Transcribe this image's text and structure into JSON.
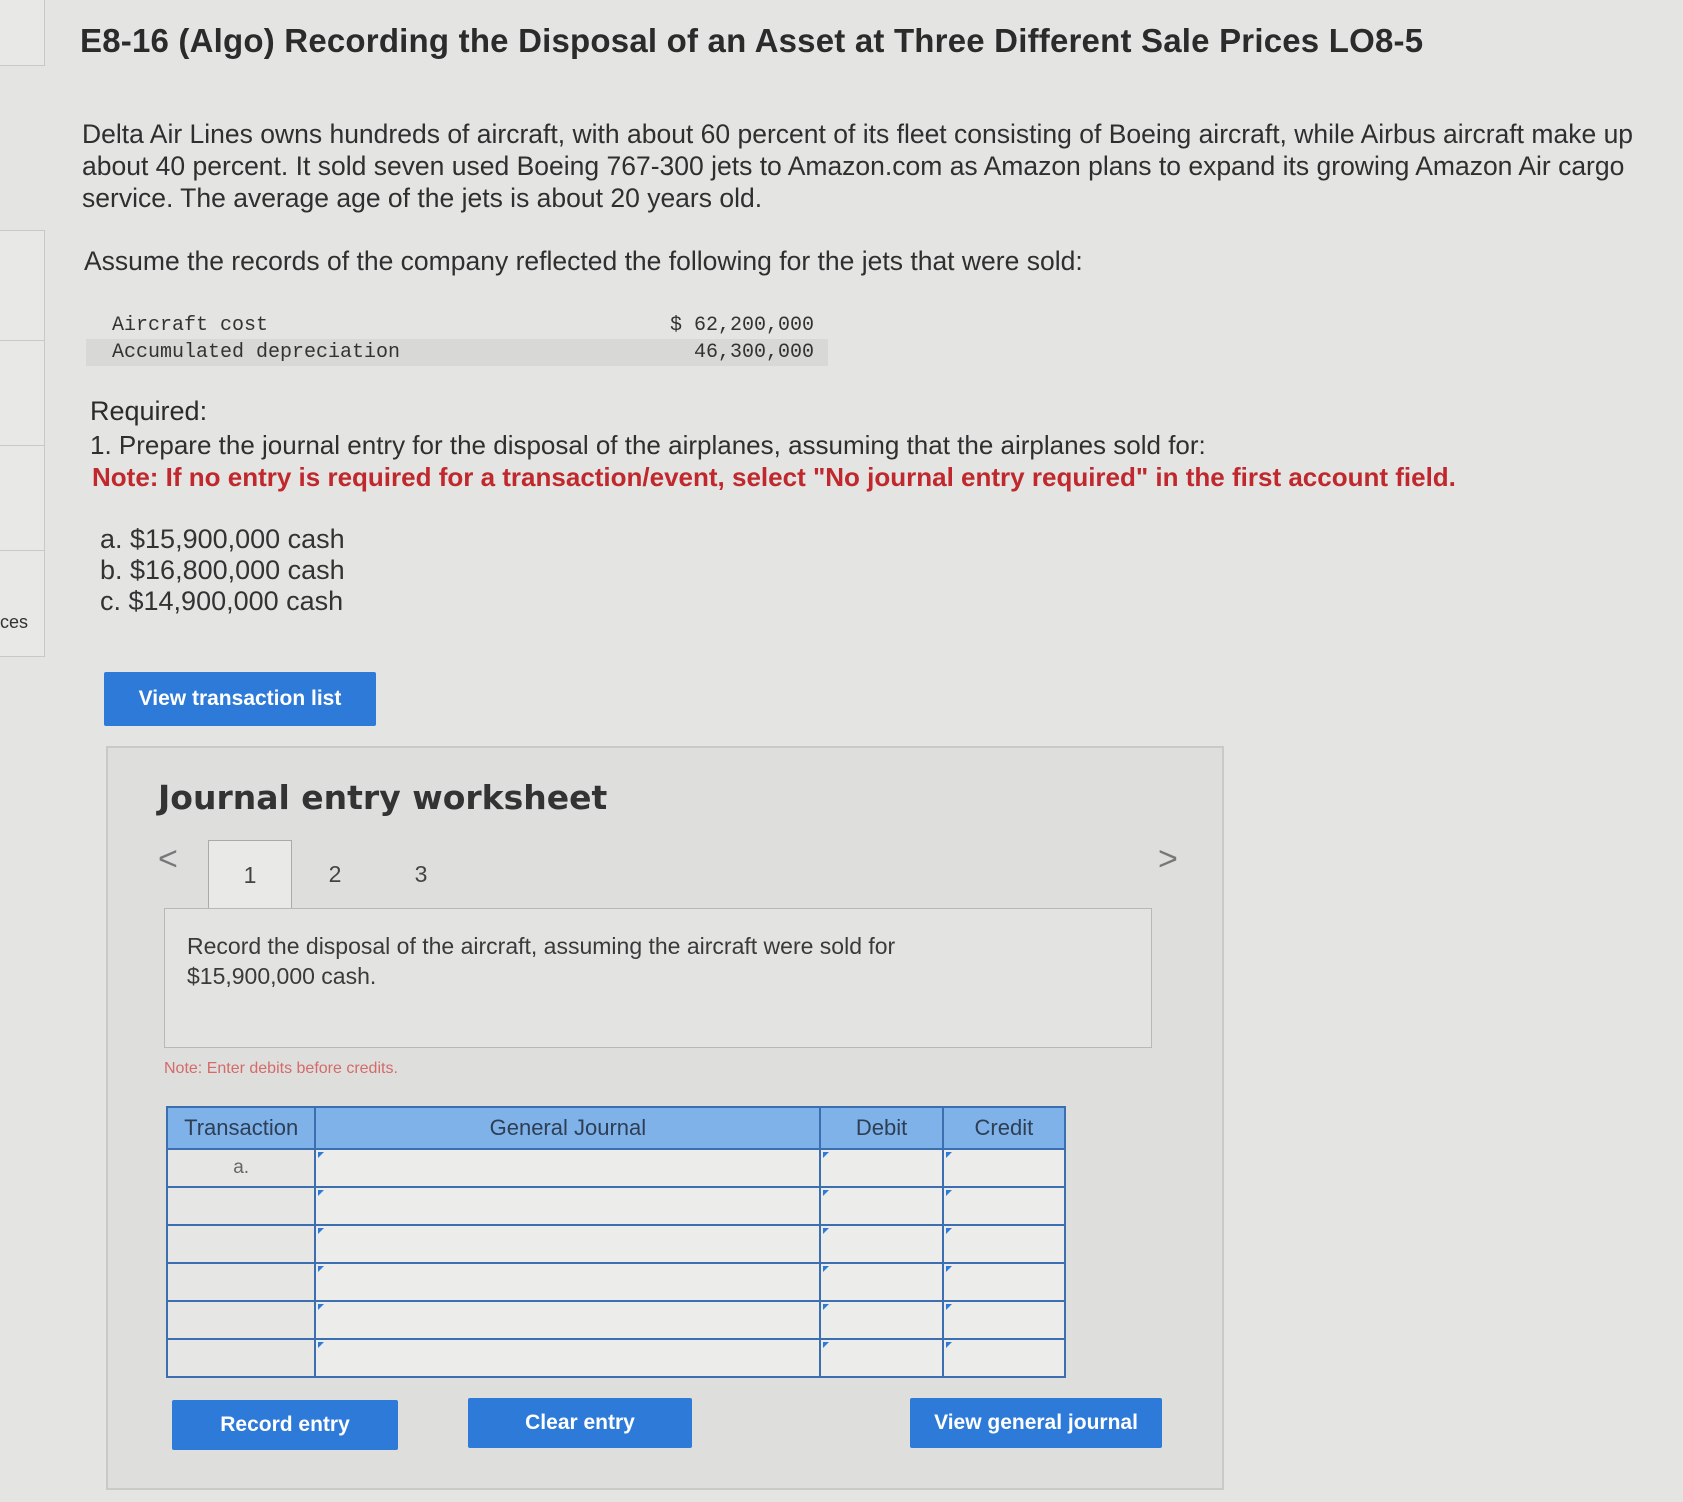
{
  "side": {
    "label": "ces"
  },
  "problem": {
    "title": "E8-16 (Algo) Recording the Disposal of an Asset at Three Different Sale Prices LO8-5",
    "paragraph_lines": [
      "Delta Air Lines owns hundreds of aircraft, with about 60 percent of its fleet consisting of Boeing aircraft, while Airbus aircraft make up",
      "about 40 percent. It sold seven used Boeing 767-300 jets to Amazon.com as Amazon plans to expand its growing Amazon Air cargo",
      "service. The average age of the jets is about 20 years old."
    ],
    "assume": "Assume the records of the company reflected the following for the jets that were sold:",
    "records": [
      {
        "label": "Aircraft cost",
        "value": "$ 62,200,000"
      },
      {
        "label": "Accumulated depreciation",
        "value": "46,300,000"
      }
    ],
    "required_heading": "Required:",
    "required_item": "1. Prepare the journal entry for the disposal of the airplanes, assuming that the airplanes sold for:",
    "note": "Note: If no entry is required for a transaction/event, select \"No journal entry required\" in the first account field.",
    "options": [
      "a. $15,900,000 cash",
      "b. $16,800,000 cash",
      "c. $14,900,000 cash"
    ]
  },
  "buttons": {
    "view_transaction_list": "View transaction list",
    "record_entry": "Record entry",
    "clear_entry": "Clear entry",
    "view_general_journal": "View general journal"
  },
  "worksheet": {
    "title": "Journal entry worksheet",
    "tabs": [
      "1",
      "2",
      "3"
    ],
    "active_tab": "1",
    "prompt_lines": [
      "Record the disposal of the aircraft, assuming the aircraft were sold for",
      "$15,900,000 cash."
    ],
    "note_small": "Note: Enter debits before credits.",
    "table": {
      "headers": [
        "Transaction",
        "General Journal",
        "Debit",
        "Credit"
      ],
      "first_transaction": "a."
    }
  },
  "colors": {
    "button_blue": "#2e7ad9",
    "header_blue": "#7fb2e8",
    "note_red": "#c0282d"
  }
}
